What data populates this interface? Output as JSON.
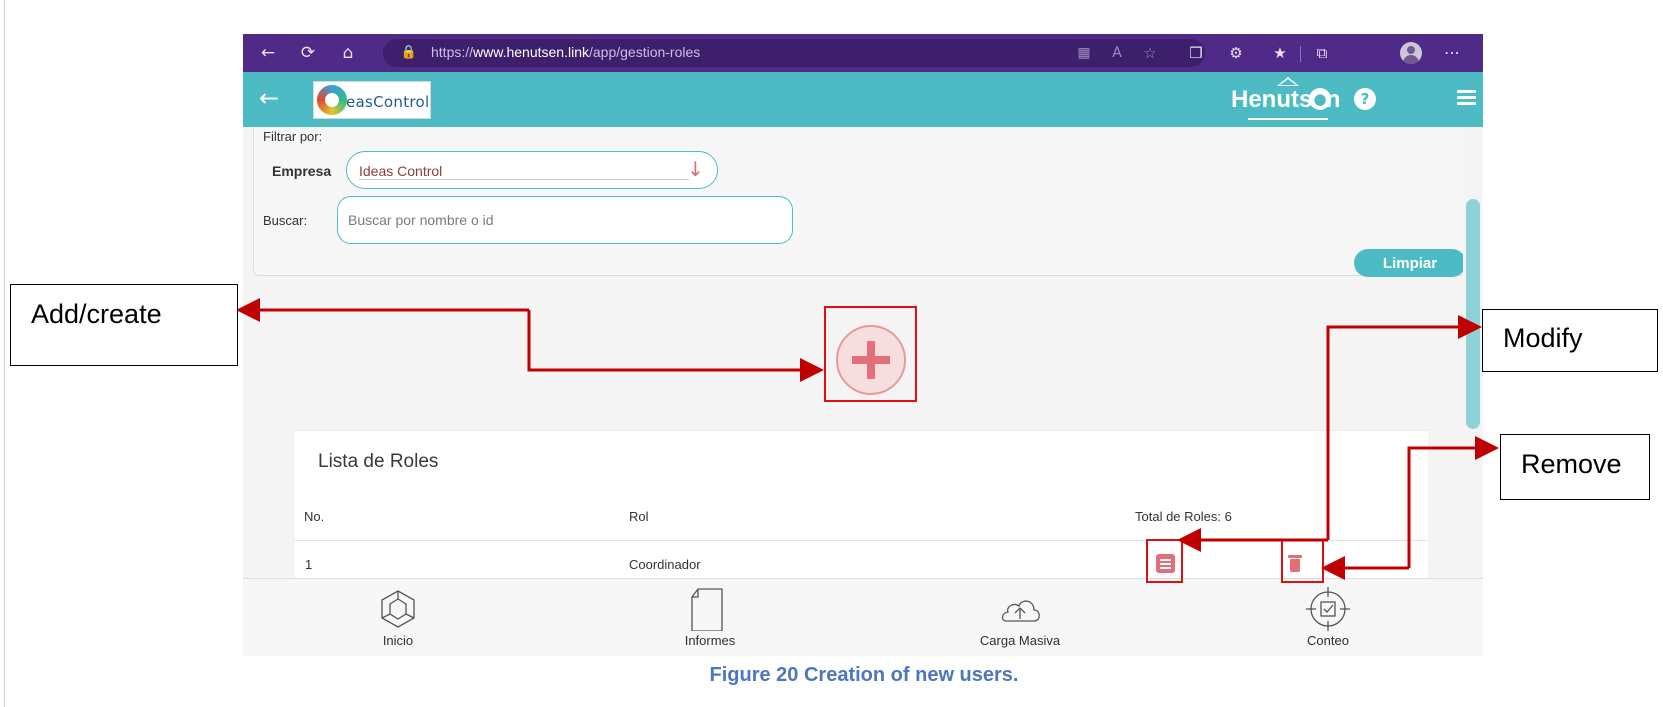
{
  "browser": {
    "url_prefix": "https://",
    "url_host": "www.henutsen.link",
    "url_path": "/app/gestion-roles",
    "icons": [
      "back-arrow-icon",
      "refresh-icon",
      "home-icon",
      "lock-icon",
      "app-grid-icon",
      "read-aloud-icon",
      "favorite-add-icon",
      "extensions-icon",
      "puzzle-icon",
      "favorites-icon",
      "collections-icon",
      "profile-avatar-icon",
      "more-icon"
    ]
  },
  "app_header": {
    "logo_text": "easControl",
    "brand": "Henutsen",
    "icons": [
      "back-icon",
      "user-icon",
      "help-icon",
      "menu-icon"
    ],
    "help_glyph": "?"
  },
  "filters": {
    "title": "Filtrar por:",
    "company_label": "Empresa",
    "company_value": "Ideas Control",
    "search_label": "Buscar:",
    "search_placeholder": "Buscar por nombre o id",
    "clear_button": "Limpiar"
  },
  "roles_list": {
    "title": "Lista de Roles",
    "columns": [
      "No.",
      "Rol"
    ],
    "total_label": "Total de Roles: 6",
    "rows": [
      {
        "no": "1",
        "rol": "Coordinador"
      }
    ]
  },
  "bottom_nav": [
    {
      "label": "Inicio",
      "icon": "cube-icon"
    },
    {
      "label": "Informes",
      "icon": "document-icon"
    },
    {
      "label": "Carga Masiva",
      "icon": "cloud-upload-icon"
    },
    {
      "label": "Conteo",
      "icon": "target-check-icon"
    }
  ],
  "annotations": {
    "add": "Add/create",
    "modify": "Modify",
    "remove": "Remove",
    "caption": "Figure 20 Creation of new users.",
    "highlight_color": "#e00f14"
  },
  "colors": {
    "browser_bar": "#4f2a86",
    "header_teal": "#4dbbc4",
    "action_red": "#e36d78",
    "caption_blue": "#4c77c0"
  }
}
